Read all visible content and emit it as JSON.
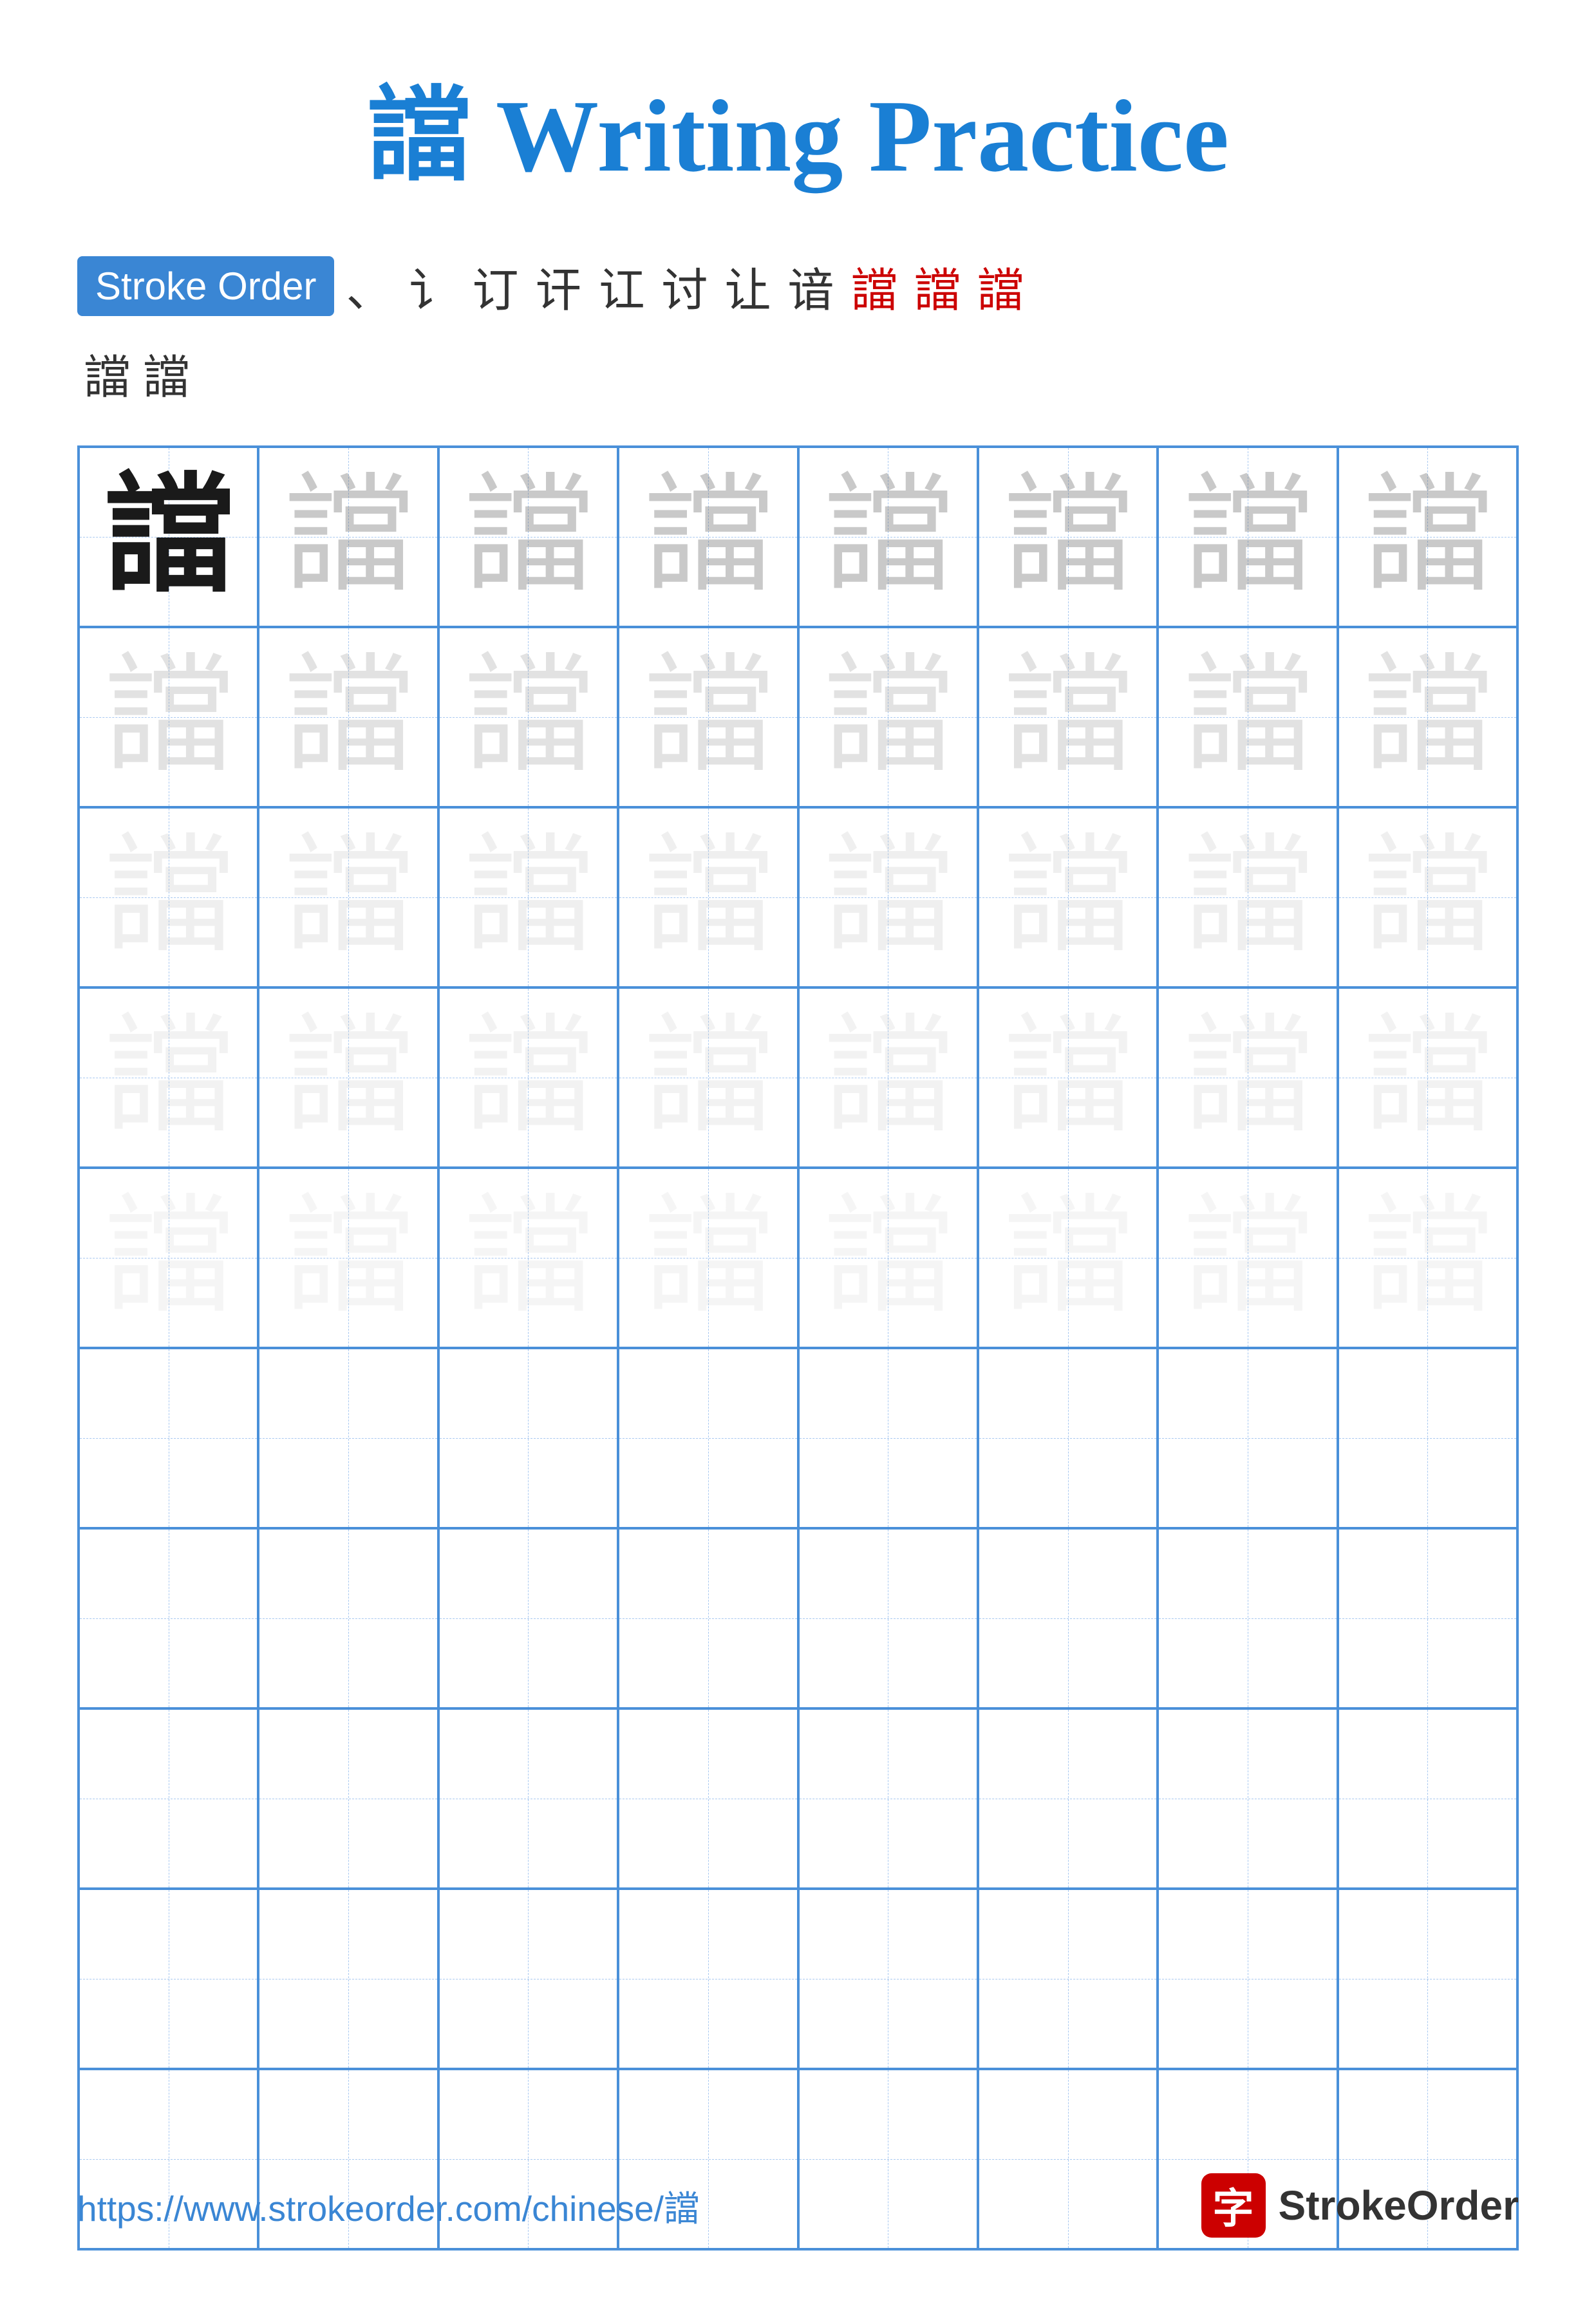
{
  "title": {
    "char": "譡",
    "suffix": " Writing Practice"
  },
  "stroke_order": {
    "label": "Stroke Order",
    "steps": [
      "、",
      "讠",
      "讠",
      "讠㇀",
      "讠⺀",
      "讠㇀⺀",
      "讠⺀讠",
      "讠⺀讠㇀",
      "譡⺀",
      "譡㇀",
      "譡"
    ],
    "extra": [
      "譡",
      "譡"
    ]
  },
  "grid": {
    "rows": 10,
    "cols": 8,
    "char": "譡",
    "practice_rows": 5,
    "empty_rows": 5
  },
  "footer": {
    "url": "https://www.strokeorder.com/chinese/譡",
    "logo_icon": "字",
    "logo_text": "StrokeOrder"
  }
}
